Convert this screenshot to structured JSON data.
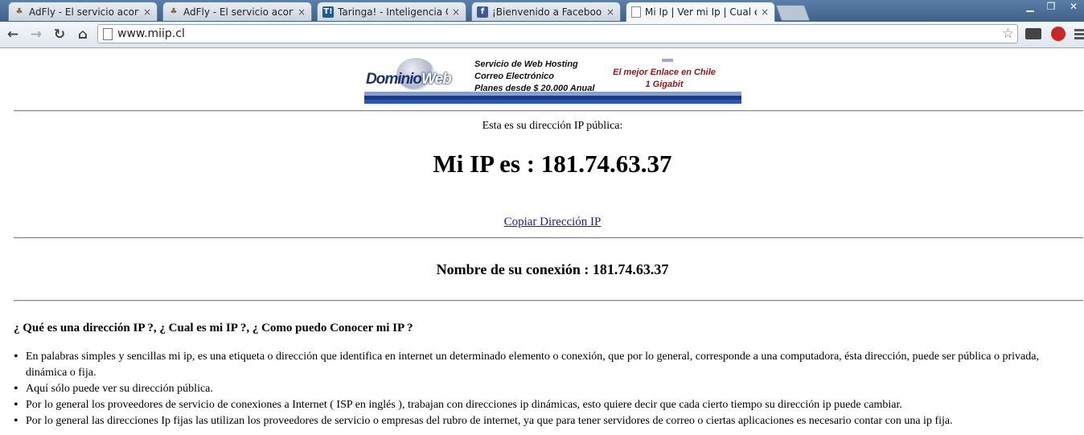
{
  "browser": {
    "tabs": [
      {
        "title": "AdFly - El servicio acortad",
        "favicon": "adfly-icon",
        "active": false
      },
      {
        "title": "AdFly - El servicio acortad",
        "favicon": "adfly-icon",
        "active": false
      },
      {
        "title": "Taringa! - Inteligencia Col",
        "favicon": "taringa-icon",
        "active": false
      },
      {
        "title": "¡Bienvenido a Facebook e",
        "favicon": "facebook-icon",
        "active": false
      },
      {
        "title": "Mi Ip | Ver mi Ip | Cual es r",
        "favicon": "page-icon",
        "active": true
      }
    ],
    "url": "www.miip.cl",
    "icons": {
      "back": "←",
      "forward": "→",
      "reload": "↻",
      "home": "⌂",
      "star": "☆",
      "tab_close": "×",
      "minimize": "▁",
      "restore": "❐",
      "close": "✕"
    },
    "favicon_glyphs": {
      "taringa": "T!",
      "facebook": "f"
    }
  },
  "banner": {
    "logo_main": "Dominio",
    "logo_accent": "Web",
    "service_lines": [
      "Servicio de Web Hosting",
      "Correo Electrónico",
      "Planes desde $ 20.000 Anual"
    ],
    "promo_lines": [
      "El mejor Enlace en Chile",
      "1 Gigabit"
    ]
  },
  "page": {
    "ip_label": "Esta es su dirección IP pública:",
    "ip_heading": "Mi IP es : 181.74.63.37",
    "copy_link": "Copiar Dirección IP",
    "connection": "Nombre de su conexión : 181.74.63.37",
    "question": "¿ Qué es una dirección IP ?, ¿ Cual es mi IP ?, ¿ Como puedo Conocer mi IP ?",
    "bullets": [
      "En palabras simples y sencillas mi ip, es una etiqueta o dirección que identifica en internet un determinado elemento o conexión, que por lo general, corresponde a una computadora, ésta dirección, puede ser pública o privada, dinámica o fija.",
      "Aquí sólo puede ver su dirección pública.",
      "Por lo general los proveedores de servicio de conexiones a Internet ( ISP en inglés ), trabajan con direcciones ip dinámicas, esto quiere decir que cada cierto tiempo su dirección ip puede cambiar.",
      "Por lo general las direcciones Ip fijas las utilizan los proveedores de servicio o empresas del rubro de internet, ya que para tener servidores de correo o ciertas aplicaciones es necesario contar con una ip fija."
    ]
  }
}
